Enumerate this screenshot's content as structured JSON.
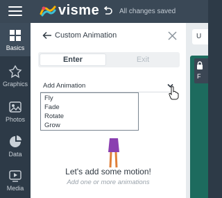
{
  "app": {
    "brand": "visme",
    "status_text": "All changes saved"
  },
  "rail": {
    "items": [
      {
        "label": "Basics",
        "icon": "basics-icon",
        "active": true
      },
      {
        "label": "Graphics",
        "icon": "graphics-icon",
        "active": false
      },
      {
        "label": "Photos",
        "icon": "photos-icon",
        "active": false
      },
      {
        "label": "Data",
        "icon": "data-icon",
        "active": false
      },
      {
        "label": "Media",
        "icon": "media-icon",
        "active": false
      }
    ]
  },
  "panel": {
    "title": "Custom Animation",
    "tabs": {
      "enter": "Enter",
      "exit": "Exit"
    },
    "select": {
      "label": "Add Animation",
      "options": [
        "Fly",
        "Fade",
        "Rotate",
        "Grow"
      ]
    },
    "empty_state": {
      "title": "Let's add some motion!",
      "subtitle": "Add one or more animations"
    }
  },
  "right": {
    "card_text": "U",
    "lock_letter": "F"
  },
  "colors": {
    "topbar": "#3a4856",
    "rail": "#2d3a47",
    "canvas": "#1d6b5e",
    "figure_dress": "#8a3fb0",
    "figure_legs": "#e0803a"
  }
}
